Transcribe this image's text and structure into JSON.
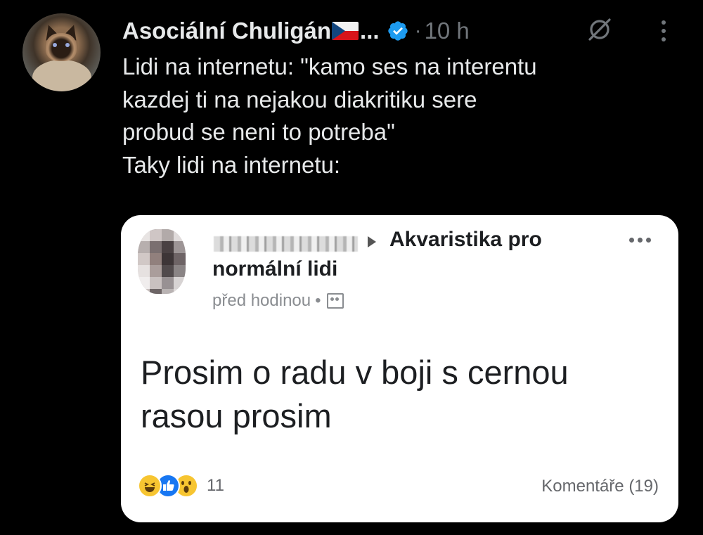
{
  "tweet": {
    "author_name": "Asociální Chuligán",
    "truncation": "...",
    "flag_icon": "czech-flag-icon",
    "verified_icon": "verified-badge-icon",
    "verified_color": "#1d9bf0",
    "dot": "·",
    "time": "10 h",
    "grok_icon": "grok-icon",
    "more_icon": "more-vertical-icon",
    "text_lines": [
      "Lidi na internetu: \"kamo ses na interentu",
      "kazdej ti na nejakou diakritiku sere",
      "probud se neni to potreba\"",
      "Taky lidi na internetu:"
    ]
  },
  "embedded_post": {
    "group_line_1": "Akvaristika pro",
    "group_line_2": "normální lidi",
    "time": "před hodinou",
    "separator": "•",
    "audience_icon": "group-audience-icon",
    "more_icon": "more-horizontal-icon",
    "text_lines": [
      "Prosim o radu v boji s cernou",
      "rasou prosim"
    ],
    "reaction_icons": [
      "haha-icon",
      "like-icon",
      "wow-icon"
    ],
    "reaction_count": "11",
    "comments_label": "Komentáře (19)"
  }
}
